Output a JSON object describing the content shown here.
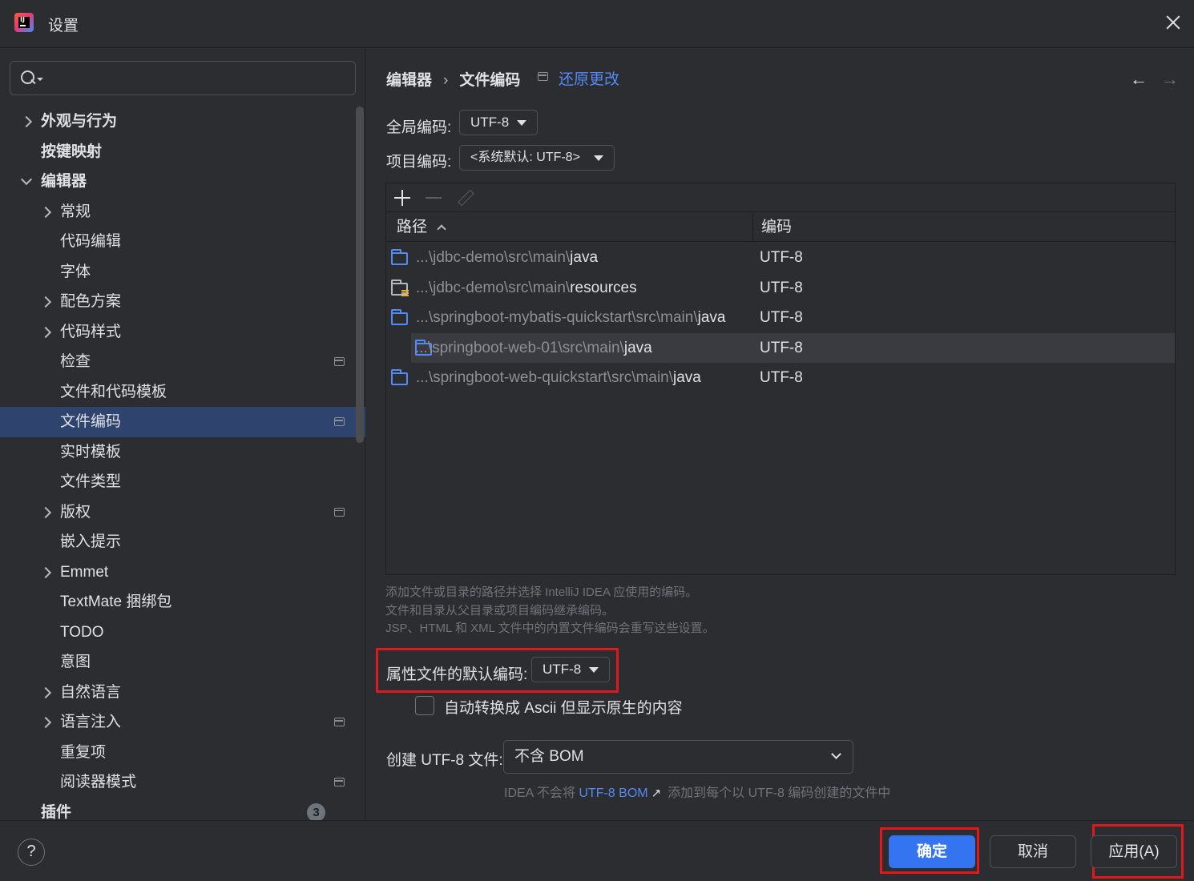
{
  "window": {
    "title": "设置",
    "close_icon": "close-icon"
  },
  "search": {
    "placeholder": "",
    "value": ""
  },
  "sidebar": {
    "items": [
      {
        "label": "外观与行为",
        "level": 0,
        "arrow": "right",
        "bold": true
      },
      {
        "label": "按键映射",
        "level": 0,
        "arrow": "none",
        "bold": true
      },
      {
        "label": "编辑器",
        "level": 0,
        "arrow": "down",
        "bold": true
      },
      {
        "label": "常规",
        "level": 1,
        "arrow": "right"
      },
      {
        "label": "代码编辑",
        "level": 1,
        "arrow": "none"
      },
      {
        "label": "字体",
        "level": 1,
        "arrow": "none"
      },
      {
        "label": "配色方案",
        "level": 1,
        "arrow": "right"
      },
      {
        "label": "代码样式",
        "level": 1,
        "arrow": "right"
      },
      {
        "label": "检查",
        "level": 1,
        "arrow": "none",
        "project_icon": true
      },
      {
        "label": "文件和代码模板",
        "level": 1,
        "arrow": "none"
      },
      {
        "label": "文件编码",
        "level": 1,
        "arrow": "none",
        "project_icon": true,
        "selected": true
      },
      {
        "label": "实时模板",
        "level": 1,
        "arrow": "none"
      },
      {
        "label": "文件类型",
        "level": 1,
        "arrow": "none"
      },
      {
        "label": "版权",
        "level": 1,
        "arrow": "right",
        "project_icon": true
      },
      {
        "label": "嵌入提示",
        "level": 1,
        "arrow": "none"
      },
      {
        "label": "Emmet",
        "level": 1,
        "arrow": "right"
      },
      {
        "label": "TextMate 捆绑包",
        "level": 1,
        "arrow": "none"
      },
      {
        "label": "TODO",
        "level": 1,
        "arrow": "none"
      },
      {
        "label": "意图",
        "level": 1,
        "arrow": "none"
      },
      {
        "label": "自然语言",
        "level": 1,
        "arrow": "right"
      },
      {
        "label": "语言注入",
        "level": 1,
        "arrow": "right",
        "project_icon": true
      },
      {
        "label": "重复项",
        "level": 1,
        "arrow": "none"
      },
      {
        "label": "阅读器模式",
        "level": 1,
        "arrow": "none",
        "project_icon": true
      },
      {
        "label": "插件",
        "level": 0,
        "arrow": "none",
        "bold": true,
        "badge": "3"
      }
    ]
  },
  "main": {
    "breadcrumb": {
      "parent": "编辑器",
      "separator": "›",
      "current": "文件编码"
    },
    "revert_label": "还原更改",
    "nav": {
      "back": "←",
      "forward": "→"
    },
    "global_encoding": {
      "label": "全局编码:",
      "value": "UTF-8"
    },
    "project_encoding": {
      "label": "项目编码:",
      "value": "<系统默认: UTF-8>"
    },
    "table": {
      "columns": {
        "path": "路径",
        "encoding": "编码"
      },
      "rows": [
        {
          "prefix": "...\\jdbc-demo\\src\\main\\",
          "name": "java",
          "encoding": "UTF-8",
          "icon": "folder-icon"
        },
        {
          "prefix": "...\\jdbc-demo\\src\\main\\",
          "name": "resources",
          "encoding": "UTF-8",
          "icon": "resources-folder-icon"
        },
        {
          "prefix": "...\\springboot-mybatis-quickstart\\src\\main\\",
          "name": "java",
          "encoding": "UTF-8",
          "icon": "folder-icon"
        },
        {
          "prefix": "...\\springboot-web-01\\src\\main\\",
          "name": "java",
          "encoding": "UTF-8",
          "icon": "folder-icon",
          "highlighted": true
        },
        {
          "prefix": "...\\springboot-web-quickstart\\src\\main\\",
          "name": "java",
          "encoding": "UTF-8",
          "icon": "folder-icon"
        }
      ]
    },
    "hint": {
      "line1": "添加文件或目录的路径并选择 IntelliJ IDEA 应使用的编码。",
      "line2": "文件和目录从父目录或项目编码继承编码。",
      "line3": "JSP、HTML 和 XML 文件中的内置文件编码会重写这些设置。"
    },
    "properties_encoding": {
      "label": "属性文件的默认编码:",
      "value": "UTF-8"
    },
    "ascii_checkbox": {
      "label": "自动转换成 Ascii 但显示原生的内容",
      "checked": false
    },
    "bom": {
      "label": "创建 UTF-8 文件:",
      "value": "不含 BOM",
      "note_prefix": "IDEA 不会将",
      "note_link": "UTF-8 BOM",
      "note_suffix": "添加到每个以 UTF-8 编码创建的文件中"
    }
  },
  "footer": {
    "help": "?",
    "ok": "确定",
    "cancel": "取消",
    "apply": "应用(A)"
  },
  "colors": {
    "background": "#2b2d30",
    "selection": "#2e436e",
    "accent": "#3574f0",
    "link": "#548af7",
    "highlight_box": "#e0181c"
  }
}
